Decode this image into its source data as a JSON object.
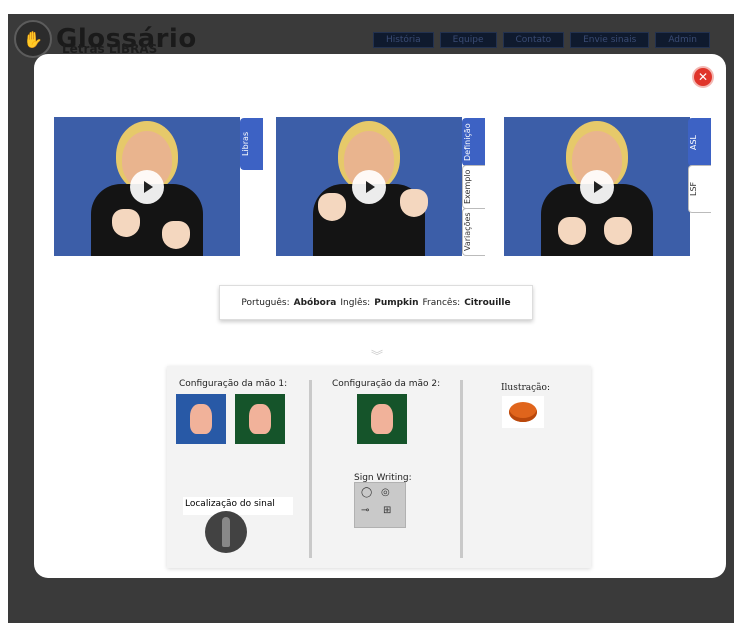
{
  "site": {
    "logo_text": "Glossário",
    "logo_sub": "Letras LIBRAS",
    "nav": [
      "História",
      "Equipe",
      "Contato",
      "Envie sinais",
      "Admin"
    ]
  },
  "modal": {
    "close_label": "✕",
    "videos": [
      {
        "tabs": [
          "Libras"
        ],
        "active": "Libras"
      },
      {
        "tabs": [
          "Definição",
          "Exemplo",
          "Variações"
        ],
        "active": "Definição"
      },
      {
        "tabs": [
          "ASL",
          "LSF"
        ],
        "active": "ASL"
      }
    ],
    "translations": {
      "pt_label": "Português:",
      "pt_value": "Abóbora",
      "en_label": "Inglês:",
      "en_value": "Pumpkin",
      "fr_label": "Francês:",
      "fr_value": "Citrouille"
    },
    "details": {
      "hand1_label": "Configuração da mão 1:",
      "hand2_label": "Configuração da mão 2:",
      "illustration_label": "Ilustração:",
      "signwriting_label": "Sign Writing:",
      "location_label": "Localização do sinal"
    }
  },
  "colors": {
    "accent": "#3d62c4",
    "close": "#e0342a",
    "background": "#3a3a3a"
  }
}
